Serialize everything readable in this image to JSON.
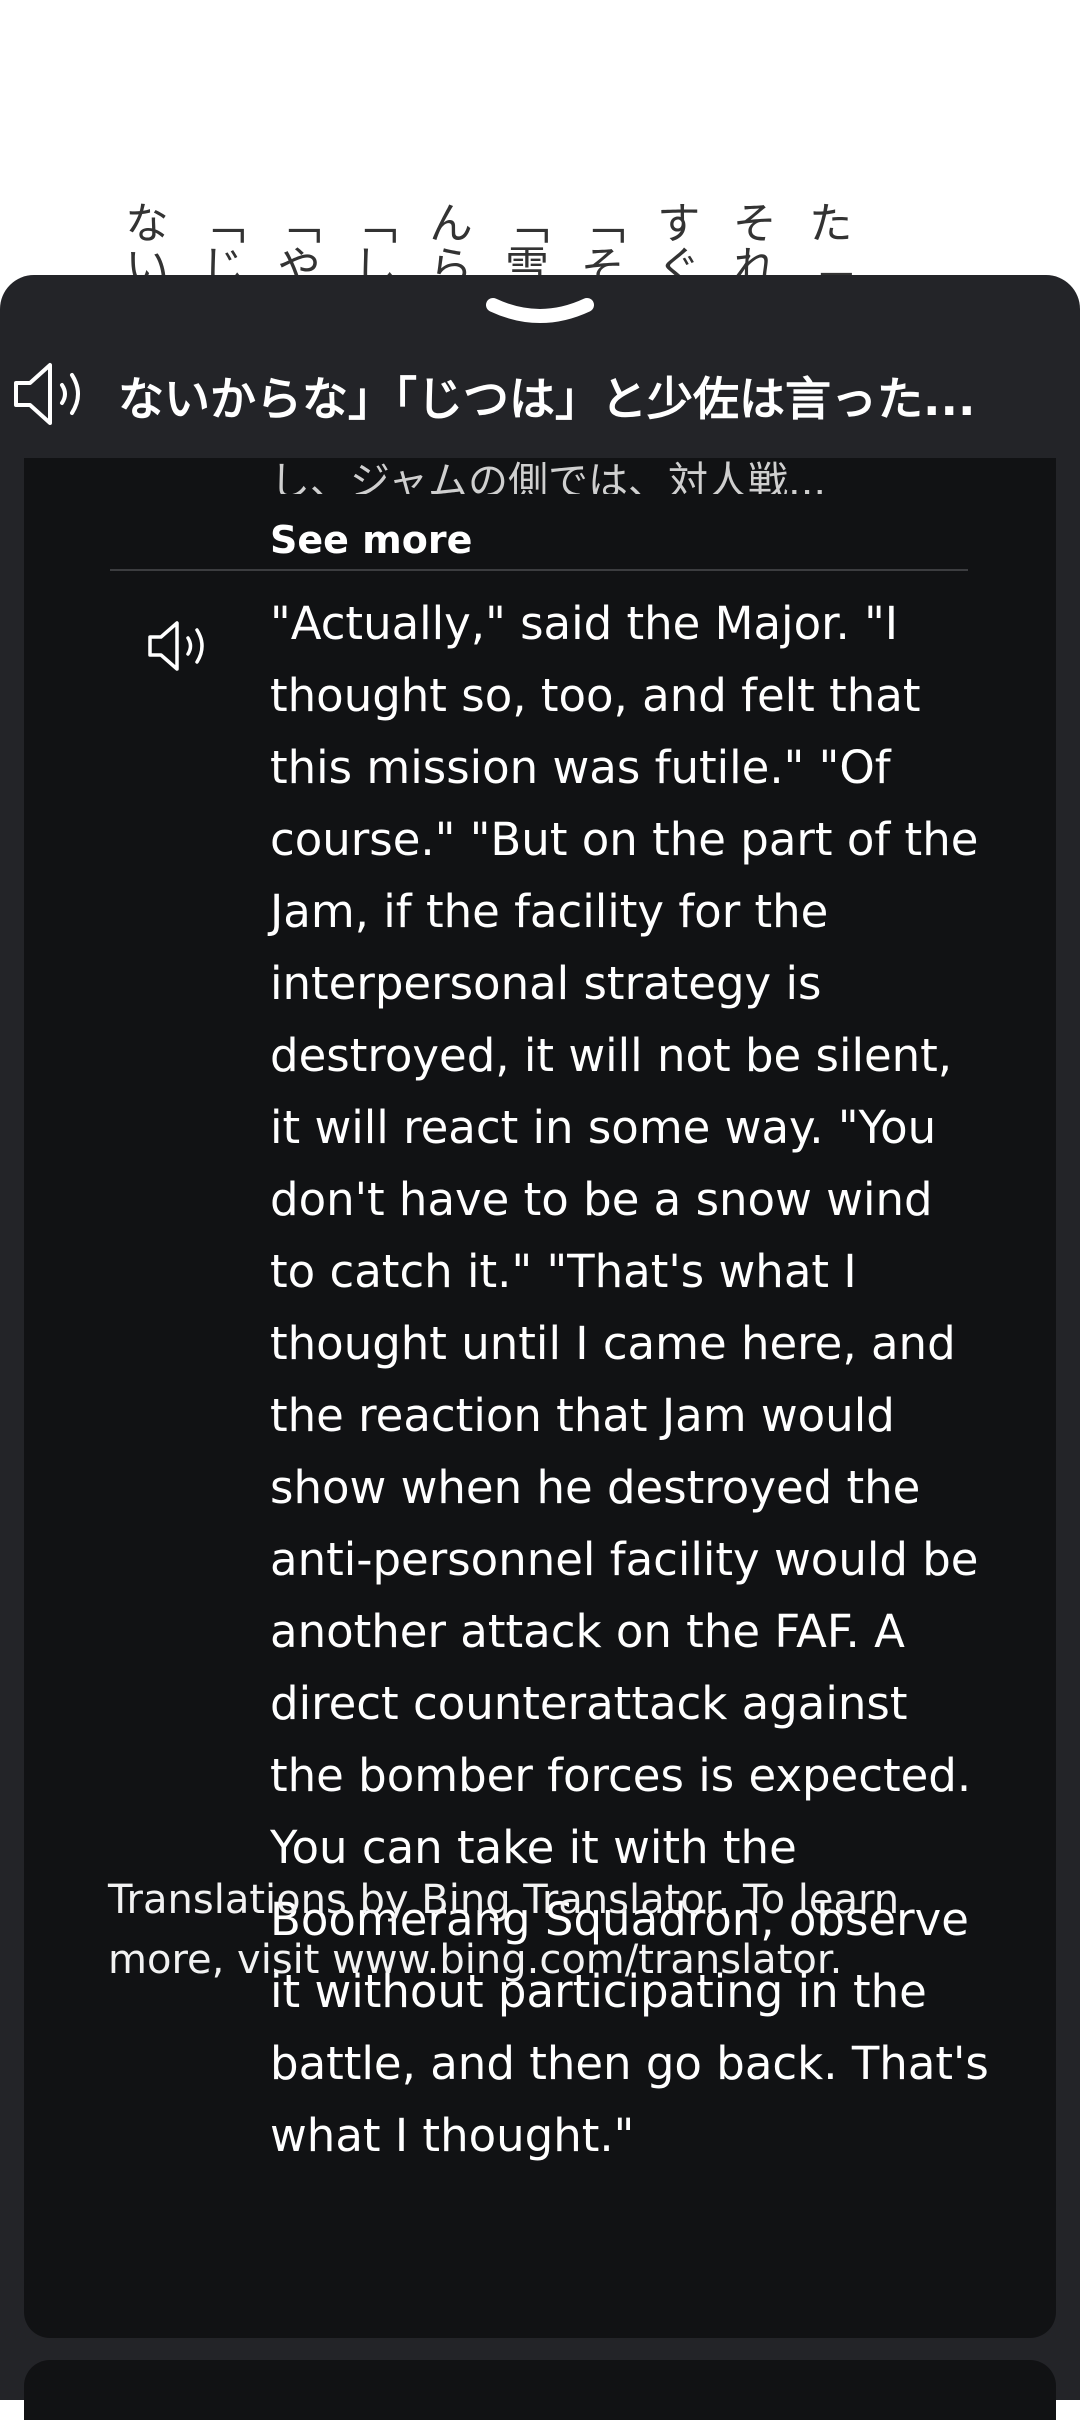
{
  "background_page": {
    "columns": [
      "た「",
      "それ",
      "すぐ",
      "「そ",
      "「雪",
      "んら",
      "「し",
      "「や",
      "「じ",
      "ない"
    ]
  },
  "sheet": {
    "header_text": "ないからな」「じつは」と少佐は言った...",
    "previous_partial_line": "し、ジャムの側では、対人戦...",
    "see_more_label": "See more",
    "translation": "\"Actually,\" said the Major. \"I thought so, too, and felt that this mission was futile.\" \"Of course.\" \"But on the part of the Jam, if the facility for the interpersonal strategy is destroyed, it will not be silent, it will react in some way. \"You don't have to be a snow wind to catch it.\" \"That's what I thought until I came here, and the reaction that Jam would show when he destroyed the anti-personnel facility would be another attack on the FAF. A direct counterattack against the bomber forces is expected. You can take it with the Boomerang Squadron, observe it without participating in the battle, and then go back. That's what I thought.\"",
    "footer": "Translations by Bing Translator. To learn more, visit www.bing.com/translator."
  },
  "icons": {
    "grabber": "chevron-down-icon",
    "header_speaker": "speaker-icon",
    "translation_speaker": "speaker-icon"
  },
  "colors": {
    "sheet_bg": "#232428",
    "panel_bg": "#111214",
    "text": "#ffffff"
  }
}
